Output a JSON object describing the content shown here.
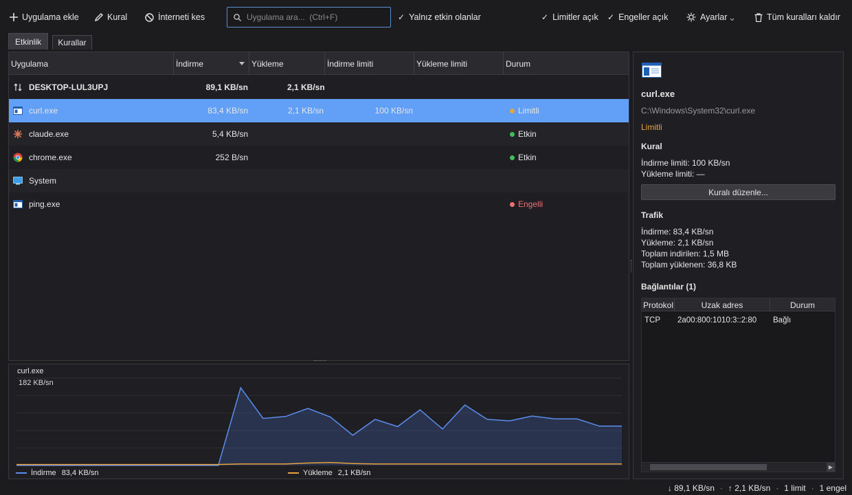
{
  "toolbar": {
    "add_app": "Uygulama ekle",
    "rule": "Kural",
    "cut_internet": "İnterneti kes",
    "search_placeholder": "Uygulama ara...  (Ctrl+F)",
    "only_active": "Yalnız etkin olanlar",
    "limits_on": "Limitler açık",
    "blocks_on": "Engeller açık",
    "settings": "Ayarlar",
    "clear_rules": "Tüm kuralları kaldır",
    "check": "✓"
  },
  "tabs": {
    "activity": "Etkinlik",
    "rules": "Kurallar"
  },
  "table": {
    "headers": {
      "app": "Uygulama",
      "download": "İndirme",
      "upload": "Yükleme",
      "download_limit": "İndirme limiti",
      "upload_limit": "Yükleme limiti",
      "status": "Durum"
    },
    "rows": [
      {
        "name": "DESKTOP-LUL3UPJ",
        "download": "89,1 KB/sn",
        "upload": "2,1 KB/sn",
        "download_limit": "",
        "status": "",
        "icon": "up-down-arrows-icon"
      },
      {
        "name": "curl.exe",
        "download": "83,4 KB/sn",
        "upload": "2,1 KB/sn",
        "download_limit": "100 KB/sn",
        "status": "Limitli",
        "icon": "window-icon"
      },
      {
        "name": "claude.exe",
        "download": "5,4 KB/sn",
        "upload": "",
        "download_limit": "",
        "status": "Etkin",
        "icon": "claude-icon"
      },
      {
        "name": "chrome.exe",
        "download": "252 B/sn",
        "upload": "",
        "download_limit": "",
        "status": "Etkin",
        "icon": "chrome-icon"
      },
      {
        "name": "System",
        "download": "",
        "upload": "",
        "download_limit": "",
        "status": "",
        "icon": "monitor-icon"
      },
      {
        "name": "ping.exe",
        "download": "",
        "upload": "",
        "download_limit": "",
        "status": "Engelli",
        "icon": "window-icon"
      }
    ]
  },
  "colors": {
    "accent": "#61a0f6",
    "limited": "#e8a33d",
    "active": "#3fbf5a",
    "blocked": "#f07070",
    "download_line": "#5b8def",
    "upload_line": "#e8a33d"
  },
  "chart_data": {
    "type": "area",
    "title": "curl.exe",
    "max_label": "182 KB/sn",
    "ylim": [
      0,
      182
    ],
    "series": [
      {
        "name": "İndirme",
        "values": [
          0,
          0,
          0,
          0,
          0,
          0,
          0,
          0,
          0,
          0,
          162,
          98,
          102,
          119,
          101,
          63,
          96,
          81,
          116,
          76,
          126,
          96,
          93,
          103,
          97,
          97,
          82,
          82
        ]
      },
      {
        "name": "Yükleme",
        "values": [
          2,
          2,
          2,
          2,
          2,
          2,
          2,
          2,
          2,
          2,
          3,
          3,
          3,
          5,
          6,
          4,
          3,
          3,
          3,
          3,
          3,
          3,
          3,
          3,
          3,
          3,
          3,
          3
        ]
      }
    ],
    "legend": {
      "download": "İndirme",
      "download_value": "83,4 KB/sn",
      "upload": "Yükleme",
      "upload_value": "2,1 KB/sn"
    }
  },
  "detail": {
    "name": "curl.exe",
    "path": "C:\\Windows\\System32\\curl.exe",
    "status": "Limitli",
    "rule_heading": "Kural",
    "download_limit": "İndirme limiti: 100 KB/sn",
    "upload_limit": "Yükleme limiti: —",
    "edit_rule": "Kuralı düzenle...",
    "traffic_heading": "Trafik",
    "traffic": {
      "download": "İndirme: 83,4 KB/sn",
      "upload": "Yükleme: 2,1 KB/sn",
      "total_down": "Toplam indirilen: 1,5 MB",
      "total_up": "Toplam yüklenen: 36,8 KB"
    },
    "connections_heading": "Bağlantılar (1)",
    "connections": {
      "headers": {
        "protocol": "Protokol",
        "remote": "Uzak adres",
        "status": "Durum"
      },
      "rows": [
        {
          "protocol": "TCP",
          "remote": "2a00:800:1010:3::2:80",
          "status": "Bağlı"
        }
      ]
    }
  },
  "statusbar": {
    "down": "↓ 89,1 KB/sn",
    "up": "↑ 2,1 KB/sn",
    "limits": "1 limit",
    "blocks": "1 engel",
    "sep": "·"
  }
}
